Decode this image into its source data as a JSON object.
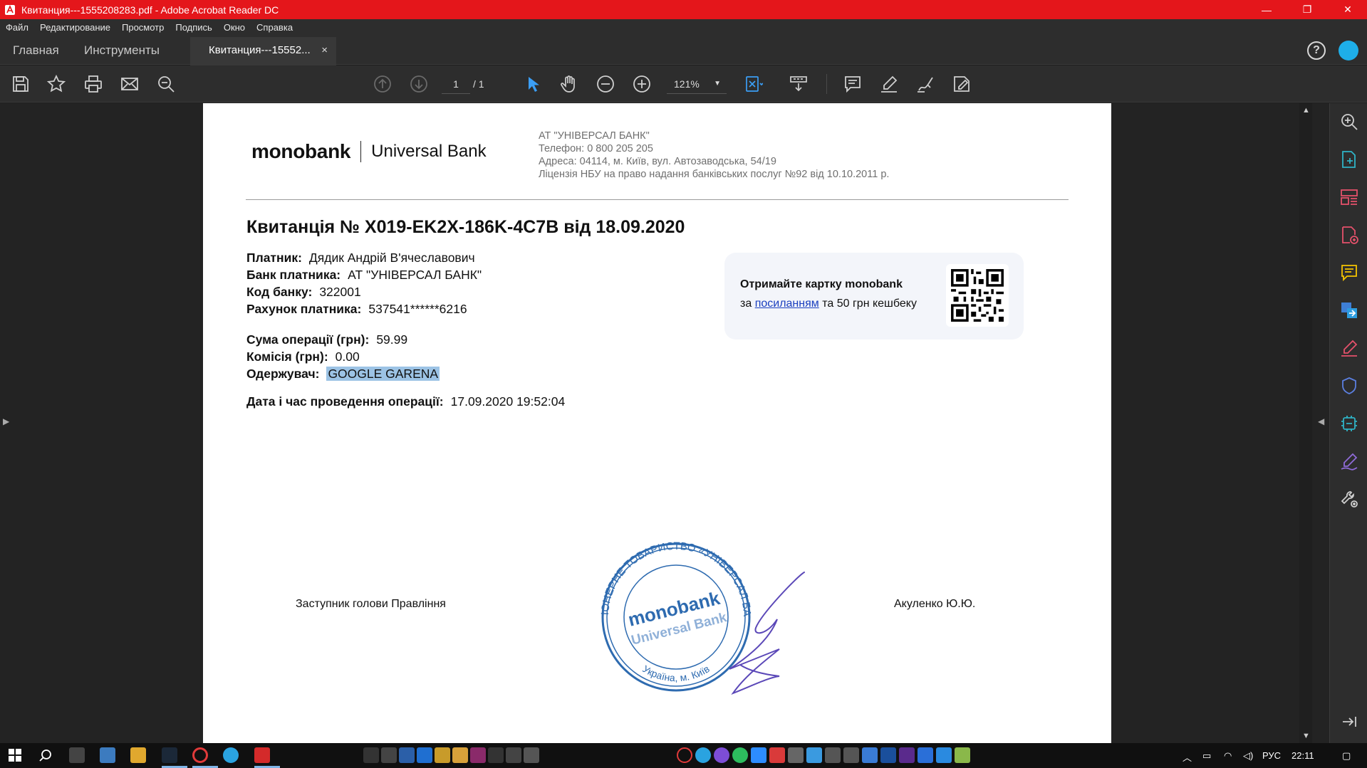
{
  "window": {
    "title": "Квитанция---1555208283.pdf - Adobe Acrobat Reader DC",
    "controls": {
      "minimize": "—",
      "restore": "❐",
      "close": "✕"
    }
  },
  "menu": [
    "Файл",
    "Редактирование",
    "Просмотр",
    "Подпись",
    "Окно",
    "Справка"
  ],
  "tabs": {
    "home": "Главная",
    "tools": "Инструменты",
    "document": "Квитанция---15552...",
    "close": "×",
    "help": "?"
  },
  "toolbar": {
    "page_current": "1",
    "page_total": "/ 1",
    "zoom": "121%"
  },
  "document": {
    "logo_mono": "monobank",
    "logo_bank": "Universal Bank",
    "bank_lines": [
      "АТ \"УНІВЕРСАЛ БАНК\"",
      "Телефон:  0 800 205 205",
      "Адреса:  04114, м. Київ, вул. Автозаводська, 54/19",
      "Ліцензія НБУ на право надання банківських послуг №92 від 10.10.2011 р."
    ],
    "title": "Квитанція № X019-EK2X-186K-4C7B від 18.09.2020",
    "fields": [
      {
        "label": "Платник:",
        "value": "Дядик Андрій В'ячеславович"
      },
      {
        "label": "Банк платника:",
        "value": "АТ \"УНІВЕРСАЛ БАНК\""
      },
      {
        "label": "Код банку:",
        "value": "322001"
      },
      {
        "label": "Рахунок платника:",
        "value": "537541******6216"
      },
      {
        "label": "Сума операції (грн):",
        "value": "59.99"
      },
      {
        "label": "Комісія (грн):",
        "value": "0.00"
      },
      {
        "label": "Одержувач:",
        "value": "GOOGLE GARENA"
      },
      {
        "label": "Дата і час проведення операції:",
        "value": "17.09.2020 19:52:04"
      }
    ],
    "promo": {
      "title": "Отримайте картку monobank",
      "prefix": "за",
      "link": "посиланням",
      "suffix": "та 50 грн кешбеку"
    },
    "signer_title": "Заступник голови Правління",
    "signer_name": "Акуленко Ю.Ю.",
    "stamp": {
      "ring_text": "АКЦІОНЕРНЕ ТОВАРИСТВО «УНІВЕРСАЛ БАНК»",
      "bottom_text": "Україна, м. Київ",
      "center_top": "monobank",
      "center_bottom": "Universal Bank"
    }
  },
  "taskbar": {
    "language": "РУС",
    "time": "22:11"
  },
  "colors": {
    "titlebar": "#e4161b",
    "chrome": "#2d2d2d",
    "accent_blue": "#1eaee8",
    "highlight": "#9cc3e5",
    "stamp_blue": "#2e6bb0"
  }
}
